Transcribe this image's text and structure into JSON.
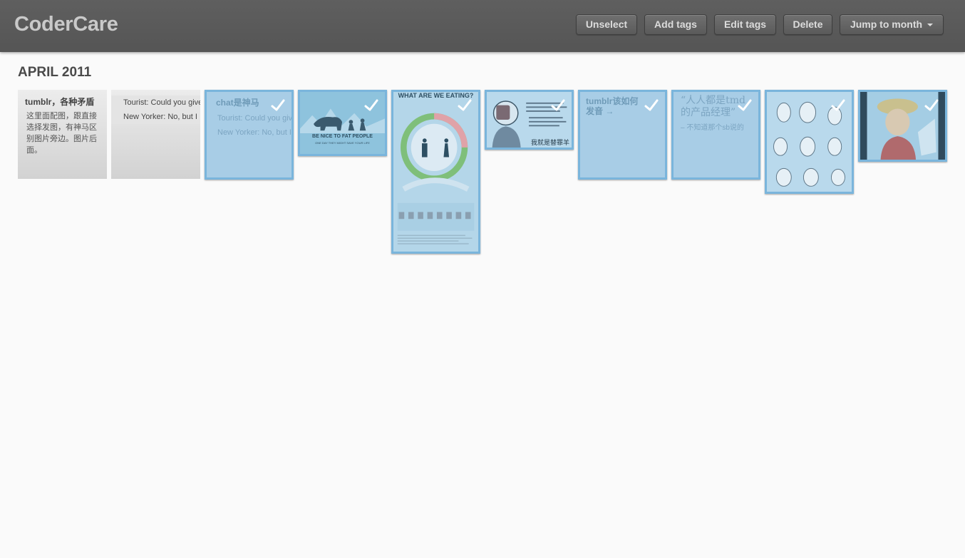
{
  "app": {
    "brand": "CoderCare"
  },
  "toolbar": {
    "unselect": "Unselect",
    "add_tags": "Add tags",
    "edit_tags": "Edit tags",
    "delete": "Delete",
    "jump_to_month": "Jump to month"
  },
  "archive": {
    "month_heading": "APRIL 2011",
    "posts": [
      {
        "type": "text",
        "selected": false,
        "title": "tumblr，各种矛盾",
        "body": "这里面配图，跟直接选择发图，有神马区别图片旁边。图片后面。"
      },
      {
        "type": "chat",
        "selected": false,
        "lines": [
          "Tourist: Could you give me directions",
          "New Yorker: No, but I"
        ]
      },
      {
        "type": "chat",
        "selected": true,
        "title": "chat是神马",
        "lines": [
          "Tourist: Could you give",
          "New Yorker: No, but I"
        ]
      },
      {
        "type": "photo",
        "selected": true,
        "caption_main": "BE NICE TO FAT PEOPLE",
        "caption_sub": "ONE DAY THEY MIGHT SAVE YOUR LIFE"
      },
      {
        "type": "photo",
        "selected": true,
        "caption_main": "WHAT ARE WE EATING?"
      },
      {
        "type": "photo",
        "selected": true,
        "caption_main": "我就是替罪羊"
      },
      {
        "type": "text",
        "selected": true,
        "title": "tumblr该如何发音 →"
      },
      {
        "type": "quote",
        "selected": true,
        "quote": "“人人都是tmd的产品经理”",
        "source": "– 不知道那个sb说的"
      },
      {
        "type": "photo",
        "selected": true
      },
      {
        "type": "photo",
        "selected": true
      }
    ]
  },
  "icons": {
    "check": "checkmark-icon",
    "caret": "caret-down-icon"
  },
  "colors": {
    "selection_fill": "#a8cde6",
    "selection_border": "#7ab5dc",
    "topbar": "#5a5a5a"
  }
}
